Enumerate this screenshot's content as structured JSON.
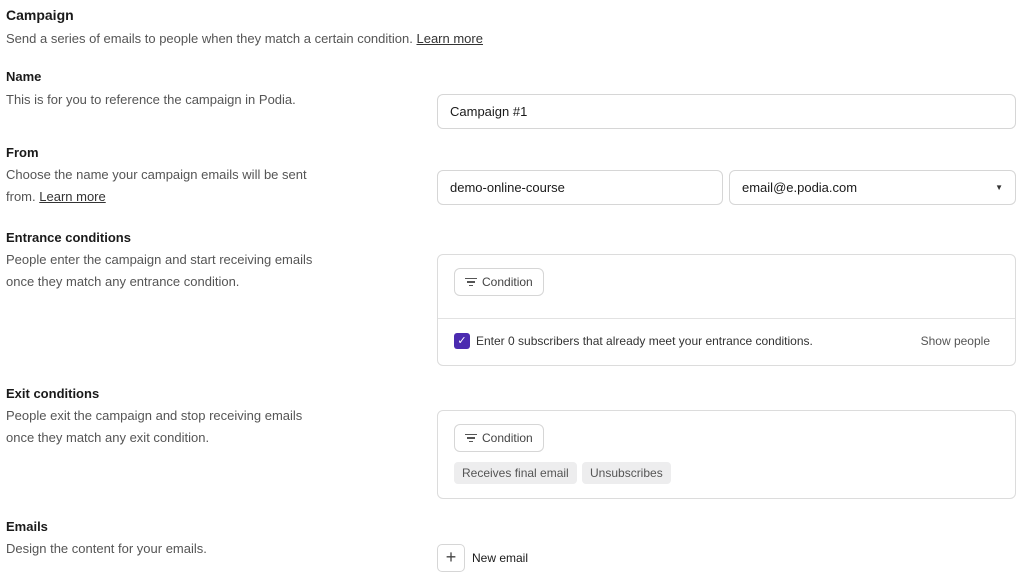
{
  "campaign": {
    "title": "Campaign",
    "description": "Send a series of emails to people when they match a certain condition.",
    "learn_more": "Learn more"
  },
  "name": {
    "title": "Name",
    "description": "This is for you to reference the campaign in Podia.",
    "value": "Campaign #1"
  },
  "from": {
    "title": "From",
    "description_line1": "Choose the name your campaign emails will be sent",
    "description_line2": "from.",
    "learn_more": "Learn more",
    "sender_name": "demo-online-course",
    "sender_email": "email@e.podia.com"
  },
  "entrance": {
    "title": "Entrance conditions",
    "description_line1": "People enter the campaign and start receiving emails",
    "description_line2": "once they match any entrance condition.",
    "condition_button": "Condition",
    "checkbox_label": "Enter 0 subscribers that already meet your entrance conditions.",
    "checkbox_checked": true,
    "show_people": "Show people"
  },
  "exit": {
    "title": "Exit conditions",
    "description_line1": "People exit the campaign and stop receiving emails",
    "description_line2": "once they match any exit condition.",
    "condition_button": "Condition",
    "chips": [
      "Receives final email",
      "Unsubscribes"
    ]
  },
  "emails": {
    "title": "Emails",
    "description": "Design the content for your emails.",
    "new_email": "New email"
  },
  "colors": {
    "accent": "#4b2bb0"
  }
}
